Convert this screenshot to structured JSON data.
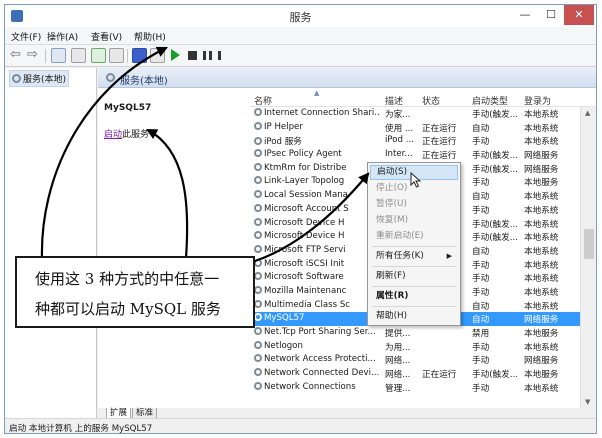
{
  "window": {
    "title": "服务",
    "controls": {
      "minimize": "—",
      "maximize": "☐",
      "close": "✕"
    }
  },
  "menu": [
    "文件(F)",
    "操作(A)",
    "查看(V)",
    "帮助(H)"
  ],
  "tree": {
    "root": "服务(本地)"
  },
  "panel": {
    "header": "服务(本地)"
  },
  "detail": {
    "service_name": "MySQL57",
    "link": "启动",
    "link_suffix": "此服务"
  },
  "columns": {
    "name": "名称",
    "desc": "描述",
    "state": "状态",
    "startup": "启动类型",
    "logon": "登录为"
  },
  "rows": [
    {
      "name": "Internet Connection Shari...",
      "desc": "为家...",
      "state": "",
      "startup": "手动(触发...",
      "logon": "本地系统"
    },
    {
      "name": "IP Helper",
      "desc": "使用 ...",
      "state": "正在运行",
      "startup": "自动",
      "logon": "本地系统"
    },
    {
      "name": "iPod 服务",
      "desc": "iPod ...",
      "state": "正在运行",
      "startup": "手动",
      "logon": "本地系统"
    },
    {
      "name": "IPsec Policy Agent",
      "desc": "Inter...",
      "state": "正在运行",
      "startup": "手动(触发...",
      "logon": "网络服务"
    },
    {
      "name": "KtmRm for Distribe",
      "desc": "",
      "state": "",
      "startup": "手动(触发...",
      "logon": "网络服务"
    },
    {
      "name": "Link-Layer Topolog",
      "desc": "",
      "state": "",
      "startup": "手动",
      "logon": "本地服务"
    },
    {
      "name": "Local Session Mana",
      "desc": "",
      "state": "",
      "startup": "自动",
      "logon": "本地系统"
    },
    {
      "name": "Microsoft Account S",
      "desc": "",
      "state": "",
      "startup": "手动",
      "logon": "本地系统"
    },
    {
      "name": "Microsoft Device H",
      "desc": "",
      "state": "",
      "startup": "手动(触发...",
      "logon": "本地系统"
    },
    {
      "name": "Microsoft Device H",
      "desc": "",
      "state": "",
      "startup": "手动(触发...",
      "logon": "本地系统"
    },
    {
      "name": "Microsoft FTP Servi",
      "desc": "",
      "state": "",
      "startup": "自动",
      "logon": "本地系统"
    },
    {
      "name": "Microsoft iSCSI Init",
      "desc": "",
      "state": "",
      "startup": "手动",
      "logon": "本地系统"
    },
    {
      "name": "Microsoft Software",
      "desc": "",
      "state": "",
      "startup": "手动",
      "logon": "本地系统"
    },
    {
      "name": "Mozilla Maintenanc",
      "desc": "",
      "state": "",
      "startup": "手动",
      "logon": "本地系统"
    },
    {
      "name": "Multimedia Class Sc",
      "desc": "",
      "state": "",
      "startup": "自动",
      "logon": "本地系统"
    },
    {
      "name": "MySQL57",
      "desc": "",
      "state": "",
      "startup": "自动",
      "logon": "网络服务",
      "selected": true
    },
    {
      "name": "Net.Tcp Port Sharing Ser...",
      "desc": "提供...",
      "state": "",
      "startup": "禁用",
      "logon": "本地服务"
    },
    {
      "name": "Netlogon",
      "desc": "为用...",
      "state": "",
      "startup": "手动",
      "logon": "本地系统"
    },
    {
      "name": "Network Access Protecti...",
      "desc": "网络...",
      "state": "",
      "startup": "手动",
      "logon": "网络服务"
    },
    {
      "name": "Network Connected Devi...",
      "desc": "网络...",
      "state": "正在运行",
      "startup": "手动(触发...",
      "logon": "本地服务"
    },
    {
      "name": "Network Connections",
      "desc": "管理...",
      "state": "",
      "startup": "手动",
      "logon": "本地系统"
    }
  ],
  "context_menu": {
    "start": "启动(S)",
    "stop": "停止(O)",
    "pause": "暂停(U)",
    "resume": "恢复(M)",
    "restart": "重新启动(E)",
    "all_tasks": "所有任务(K)",
    "refresh": "刷新(F)",
    "properties": "属性(R)",
    "help": "帮助(H)"
  },
  "tabs": {
    "extended": "扩展",
    "standard": "标准"
  },
  "status": "启动 本地计算机 上的服务 MySQL57",
  "callout": {
    "line1": "使用这 3 种方式的中任意一",
    "line2": "种都可以启动 MySQL 服务"
  },
  "colors": {
    "selection": "#3399ff",
    "start_icon": "#1a9e2a",
    "link": "#7a1fa2",
    "close_button": "#c75050"
  }
}
